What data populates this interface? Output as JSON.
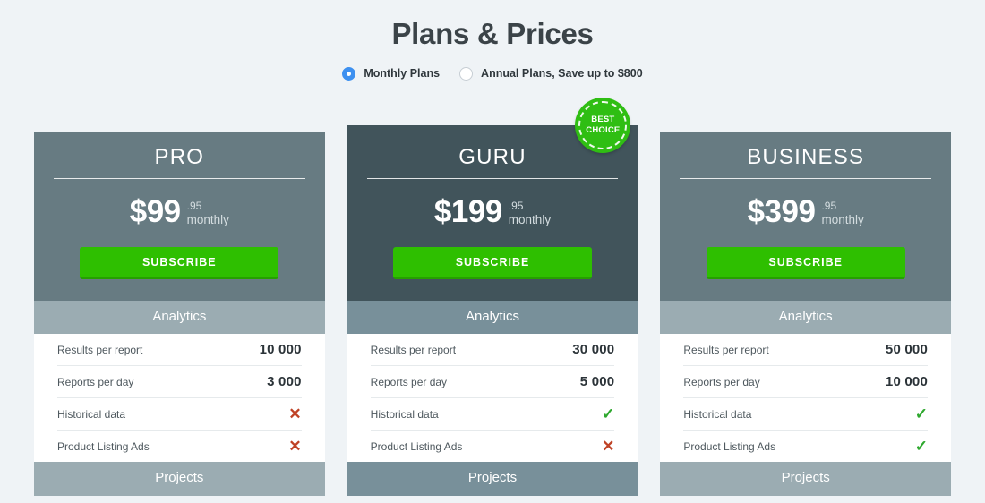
{
  "page": {
    "title": "Plans & Prices",
    "background_color": "#eff3f6"
  },
  "billing_toggle": {
    "options": [
      {
        "label": "Monthly Plans",
        "selected": true
      },
      {
        "label": "Annual Plans, Save up to $800",
        "selected": false
      }
    ]
  },
  "badge": {
    "line1": "BEST",
    "line2": "CHOICE",
    "color": "#2fbe13"
  },
  "section_labels": {
    "analytics": "Analytics",
    "projects": "Projects"
  },
  "feature_labels": {
    "results_per_report": "Results per report",
    "reports_per_day": "Reports per day",
    "historical_data": "Historical data",
    "product_listing_ads": "Product Listing Ads"
  },
  "marks": {
    "yes": "✓",
    "no": "✕"
  },
  "colors": {
    "accent_green": "#2ebf00",
    "check_green": "#2ea82e",
    "cross_red": "#bf4226",
    "header_regular": "#677b82",
    "header_featured": "#41545b",
    "band_regular": "#9bacb2",
    "band_featured": "#78909a",
    "radio_active": "#3d90f0"
  },
  "plans": [
    {
      "name": "PRO",
      "price": "$99",
      "cents": ".95",
      "period": "monthly",
      "cta": "SUBSCRIBE",
      "featured": false,
      "analytics": {
        "results_per_report": "10 000",
        "reports_per_day": "3 000",
        "historical_data": "no",
        "product_listing_ads": "no"
      }
    },
    {
      "name": "GURU",
      "price": "$199",
      "cents": ".95",
      "period": "monthly",
      "cta": "SUBSCRIBE",
      "featured": true,
      "analytics": {
        "results_per_report": "30 000",
        "reports_per_day": "5 000",
        "historical_data": "yes",
        "product_listing_ads": "no"
      }
    },
    {
      "name": "BUSINESS",
      "price": "$399",
      "cents": ".95",
      "period": "monthly",
      "cta": "SUBSCRIBE",
      "featured": false,
      "analytics": {
        "results_per_report": "50 000",
        "reports_per_day": "10 000",
        "historical_data": "yes",
        "product_listing_ads": "yes"
      }
    }
  ]
}
